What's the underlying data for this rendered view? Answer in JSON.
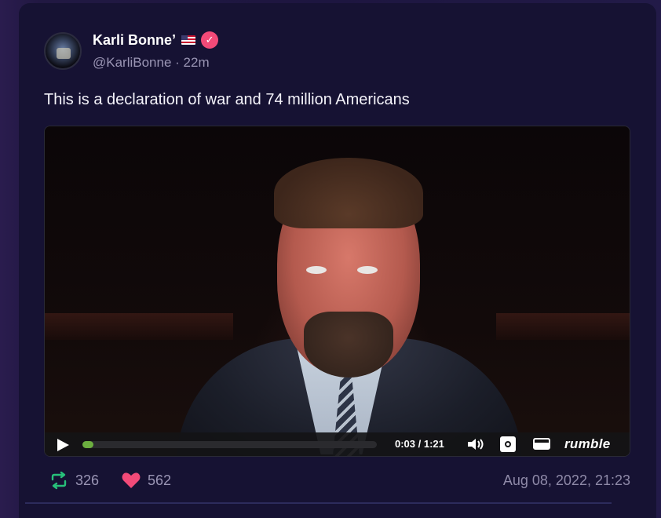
{
  "post": {
    "author_name": "Karli Bonne’",
    "handle": "@KarliBonne",
    "separator": " · ",
    "age": "22m",
    "text": "This is a declaration of war and 74 million Americans",
    "icons": {
      "flag": "us-flag-icon",
      "verified": "verified-badge-icon"
    }
  },
  "video": {
    "time_current": "0:03",
    "time_separator": " / ",
    "time_total": "1:21",
    "progress_fraction": 0.037,
    "brand": "rumble",
    "accent_color": "#6cae3f",
    "icons": [
      "play-icon",
      "volume-icon",
      "settings-icon",
      "window-icon"
    ]
  },
  "stats": {
    "reposts": "326",
    "likes": "562",
    "timestamp": "Aug 08, 2022, 21:23",
    "repost_color": "#27c07a",
    "like_color": "#f24a78"
  }
}
